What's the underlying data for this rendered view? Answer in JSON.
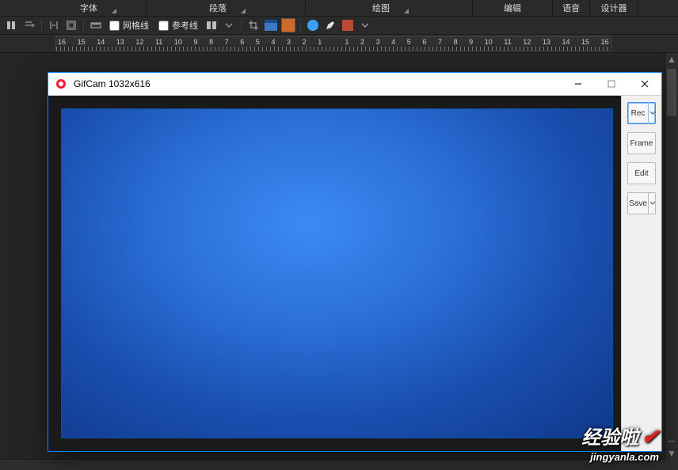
{
  "host": {
    "ribbon_groups": [
      "字体",
      "段落",
      "绘图",
      "编辑",
      "语音",
      "设计器"
    ],
    "toolbar": {
      "gridlines_label": "网格线",
      "guides_label": "参考线"
    },
    "ruler_numbers": [
      "16",
      "15",
      "14",
      "13",
      "12",
      "11",
      "10",
      "9",
      "8",
      "7",
      "6",
      "5",
      "4",
      "3",
      "2",
      "1",
      "",
      "1",
      "2",
      "3",
      "4",
      "5",
      "6",
      "7",
      "8",
      "9",
      "10",
      "11",
      "12",
      "13",
      "14",
      "15",
      "16"
    ]
  },
  "gifcam": {
    "title": "GifCam 1032x616",
    "buttons": {
      "rec": "Rec",
      "frame": "Frame",
      "edit": "Edit",
      "save": "Save"
    }
  },
  "watermark": {
    "line1": "经验啦",
    "line2": "jingyanla.com"
  }
}
